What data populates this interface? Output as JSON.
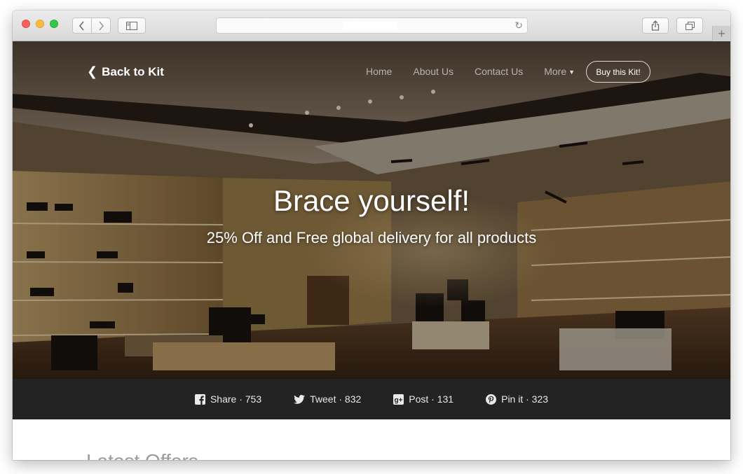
{
  "browser": {
    "colors": {
      "titlebar": "#e2e2e2",
      "close": "#fc605c",
      "minimize": "#fdbc40",
      "zoom": "#34c84a"
    },
    "icons": [
      "back-icon",
      "forward-icon",
      "sidebar-icon",
      "reload-icon",
      "share-icon",
      "tabs-icon",
      "new-tab-icon"
    ]
  },
  "header": {
    "back_label": "Back to Kit",
    "nav": [
      {
        "label": "Home"
      },
      {
        "label": "About Us"
      },
      {
        "label": "Contact Us"
      },
      {
        "label": "More"
      }
    ],
    "cta_label": "Buy this Kit!"
  },
  "hero": {
    "title": "Brace yourself!",
    "subtitle": "25% Off and Free global delivery for all products"
  },
  "social": [
    {
      "label": "Share · 753",
      "icon": "facebook-icon"
    },
    {
      "label": "Tweet · 832",
      "icon": "twitter-icon"
    },
    {
      "label": "Post · 131",
      "icon": "google-plus-icon"
    },
    {
      "label": "Pin it · 323",
      "icon": "pinterest-icon"
    }
  ],
  "section": {
    "title": "Latest Offers"
  },
  "theme": {
    "social_bar": "#232323",
    "hero_text": "#ffffff",
    "section_title": "#9b9b9b"
  }
}
